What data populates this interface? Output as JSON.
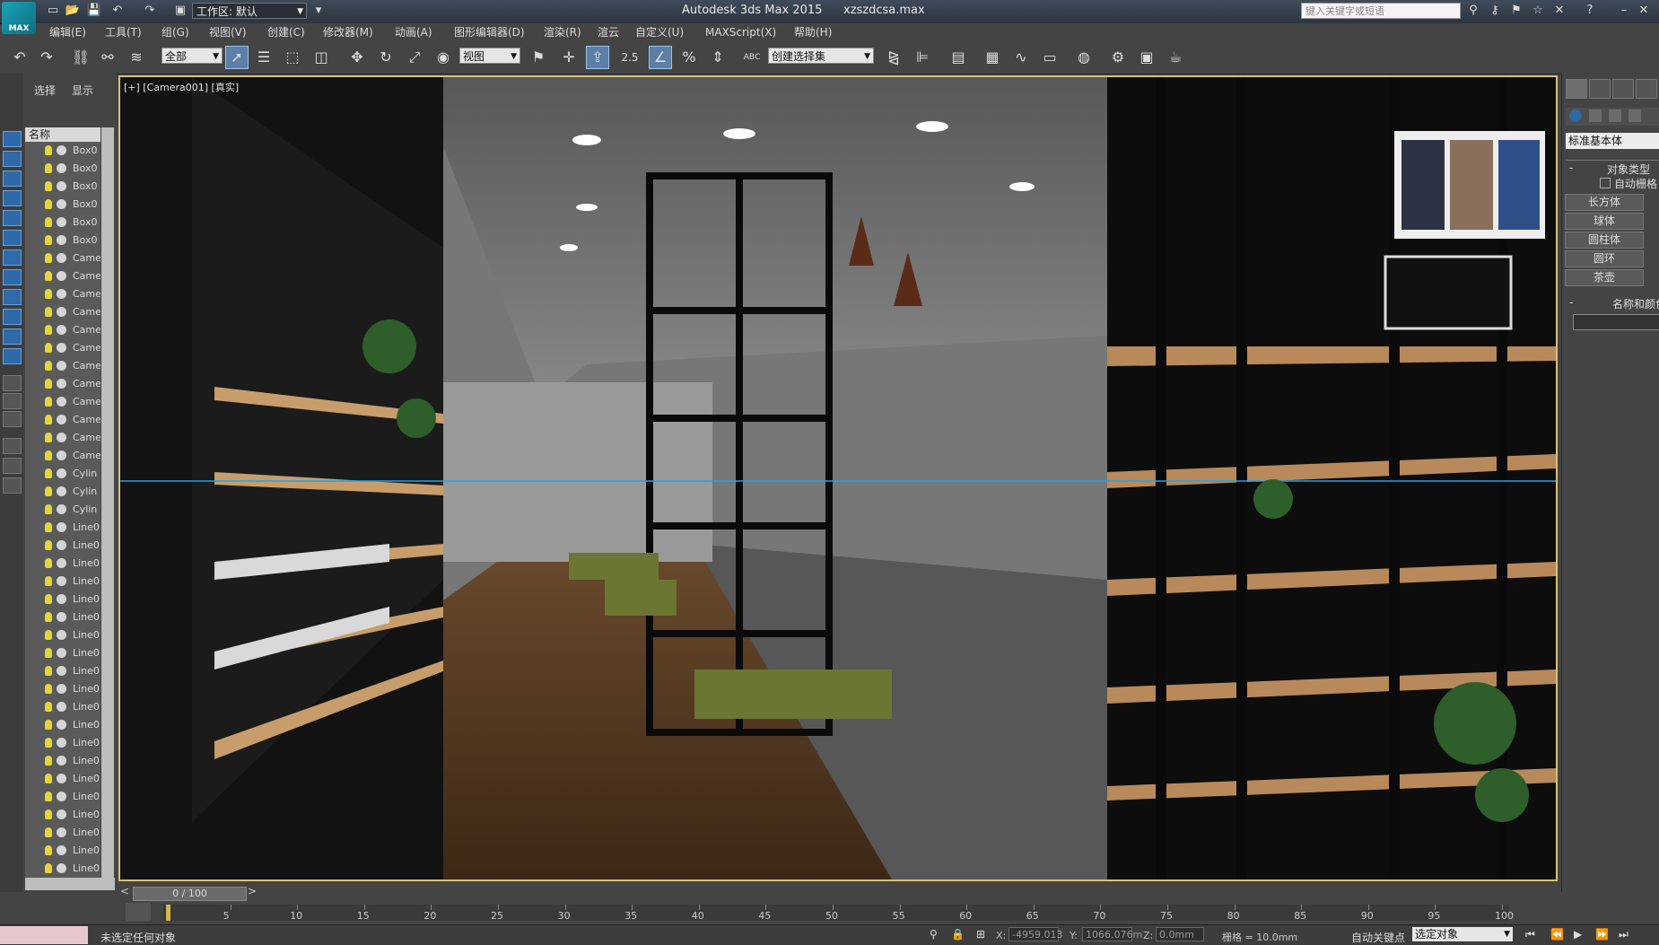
{
  "app": {
    "title": "Autodesk 3ds Max  2015",
    "filename": "xzszdcsa.max",
    "logo_text": "MAX",
    "workspace": "工作区: 默认",
    "search_placeholder": "键入关键字或短语"
  },
  "menu": [
    "编辑(E)",
    "工具(T)",
    "组(G)",
    "视图(V)",
    "创建(C)",
    "修改器(M)",
    "动画(A)",
    "图形编辑器(D)",
    "渲染(R)",
    "渲云",
    "自定义(U)",
    "MAXScript(X)",
    "帮助(H)"
  ],
  "toolbar": {
    "selection_filter": "全部",
    "ref_coord": "视图",
    "snap_value": "2.5",
    "named_selection": "创建选择集",
    "abc": "ABC"
  },
  "scene_explorer": {
    "tabs": [
      "选择",
      "显示"
    ],
    "column_header": "名称",
    "items": [
      "Box0",
      "Box0",
      "Box0",
      "Box0",
      "Box0",
      "Box0",
      "Came",
      "Came",
      "Came",
      "Came",
      "Came",
      "Came",
      "Came",
      "Came",
      "Came",
      "Came",
      "Came",
      "Came",
      "Cylin",
      "Cylin",
      "Cylin",
      "Line0",
      "Line0",
      "Line0",
      "Line0",
      "Line0",
      "Line0",
      "Line0",
      "Line0",
      "Line0",
      "Line0",
      "Line0",
      "Line0",
      "Line0",
      "Line0",
      "Line0",
      "Line0",
      "Line0",
      "Line0",
      "Line0",
      "Line0"
    ]
  },
  "viewport": {
    "label": "[+] [Camera001] [真实]"
  },
  "command_panel": {
    "category": "标准基本体",
    "rollout_object_type": "对象类型",
    "autogrid": "自动栅格",
    "buttons": [
      "长方体",
      "球体",
      "圆柱体",
      "圆环",
      "茶壶"
    ],
    "rollout_name_color": "名称和颜色"
  },
  "timeline": {
    "frame_display": "0 / 100",
    "ticks": [
      "5",
      "10",
      "15",
      "20",
      "25",
      "30",
      "35",
      "40",
      "45",
      "50",
      "55",
      "60",
      "65",
      "70",
      "75",
      "80",
      "85",
      "90",
      "95",
      "100"
    ]
  },
  "status": {
    "message": "未选定任何对象",
    "x_label": "X:",
    "x_value": "-4959.013",
    "y_label": "Y:",
    "y_value": "1066.076m",
    "z_label": "Z:",
    "z_value": "0.0mm",
    "grid": "栅格 = 10.0mm",
    "autokey": "自动关键点",
    "selected": "选定对象"
  }
}
